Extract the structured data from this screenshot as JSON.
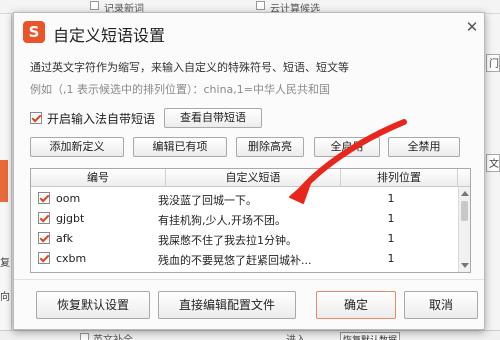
{
  "background": {
    "top_items": [
      "记录新词",
      "云计算候选"
    ],
    "bottom_items": [
      "英文补全",
      "进入",
      "恢复默认数据"
    ],
    "side_letters": [
      "复",
      "向"
    ],
    "right_letters": [
      "文",
      "门"
    ]
  },
  "dialog": {
    "title": "自定义短语设置",
    "logo": "S",
    "description": "通过英文字符作为缩写，来输入自定义的特殊符号、短语、短文等",
    "example": "例如（,1 表示候选中的排列位置）：china,1=中华人民共和国",
    "enable_builtin_label": "开启输入法自带短语",
    "view_builtin_label": "查看自带短语",
    "toolbar": {
      "add": "添加新定义",
      "edit": "编辑已有项",
      "delete": "删除高亮",
      "enable_all": "全启用",
      "disable_all": "全禁用"
    },
    "columns": [
      "编号",
      "自定义短语",
      "排列位置"
    ],
    "rows": [
      {
        "abbr": "oom",
        "phrase": "我没蓝了回城一下。",
        "pos": "1"
      },
      {
        "abbr": "gjgbt",
        "phrase": "有挂机狗,少人,开场不团。",
        "pos": "1"
      },
      {
        "abbr": "afk",
        "phrase": "我屎憋不住了我去拉1分钟。",
        "pos": "1"
      },
      {
        "abbr": "cxbm",
        "phrase": "残血的不要晃悠了赶紧回城补...",
        "pos": "1"
      }
    ],
    "buttons": {
      "restore": "恢复默认设置",
      "edit_config": "直接编辑配置文件",
      "ok": "确定",
      "cancel": "取消"
    }
  },
  "annotation": {
    "color": "#e8261c"
  }
}
